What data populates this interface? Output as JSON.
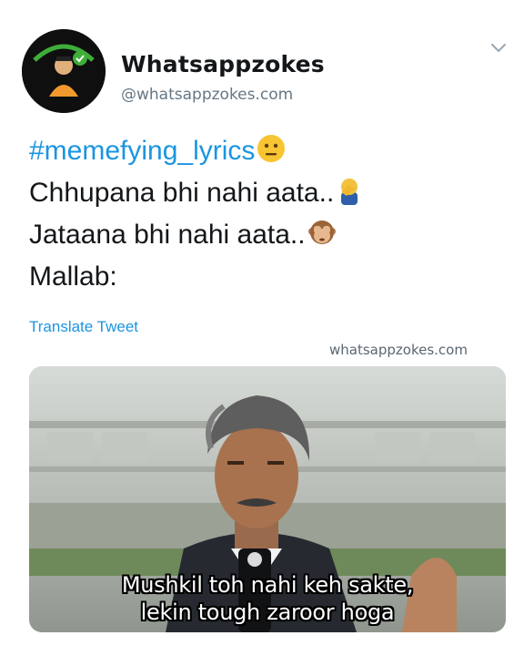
{
  "account": {
    "display_name": "Whatsappzokes",
    "handle": "@whatsappzokes.com",
    "avatar_icon": "avatar-logo-icon",
    "menu_icon": "chevron-down-icon"
  },
  "tweet": {
    "hashtag": "#memefying_lyrics",
    "lines": [
      "Chhupana bhi nahi aata..",
      "Jataana bhi nahi aata..",
      "Mallab:"
    ],
    "emojis": [
      "neutral-face-icon",
      "facepalm-icon",
      "see-no-evil-monkey-icon"
    ],
    "translate_label": "Translate Tweet"
  },
  "watermark": "whatsappzokes.com",
  "media": {
    "caption_line_1": "Mushkil toh nahi keh sakte,",
    "caption_line_2": "lekin tough zaroor hoga"
  },
  "colors": {
    "link_blue": "#1b95e0",
    "text_dark": "#14171a",
    "handle_gray": "#657786"
  }
}
